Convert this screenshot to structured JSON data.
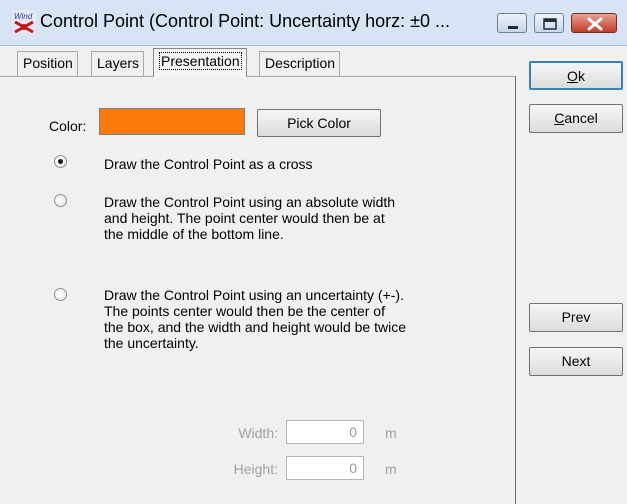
{
  "window": {
    "title": "Control Point   (Control Point: Uncertainty horz: ±0 ...",
    "app_icon": "wind-app-icon",
    "controls": [
      "minimize-icon",
      "maximize-icon",
      "close-icon"
    ]
  },
  "tabs": [
    {
      "label": "Position",
      "active": false
    },
    {
      "label": "Layers",
      "active": false
    },
    {
      "label": "Presentation",
      "active": true
    },
    {
      "label": "Description",
      "active": false
    }
  ],
  "presentation": {
    "color_label": "Color:",
    "color_value": "#fc7a0a",
    "pick_color_label": "Pick Color",
    "options": [
      {
        "lines": [
          "Draw the Control Point as a cross"
        ],
        "selected": true
      },
      {
        "lines": [
          "Draw the Control Point using an absolute width",
          "and height. The point center would then be at",
          "the middle of the bottom line."
        ],
        "selected": false
      },
      {
        "lines": [
          "Draw the Control Point using an uncertainty (+-).",
          "The points center would then be the center of",
          "the box, and the width and height would be twice",
          "the uncertainty."
        ],
        "selected": false
      }
    ],
    "width_label": "Width:",
    "width_value": "0",
    "width_unit": "m",
    "height_label": "Height:",
    "height_value": "0",
    "height_unit": "m"
  },
  "buttons": {
    "ok_mnemonic": "O",
    "ok_rest": "k",
    "cancel_mnemonic": "C",
    "cancel_rest": "ancel",
    "prev": "Prev",
    "next": "Next"
  }
}
